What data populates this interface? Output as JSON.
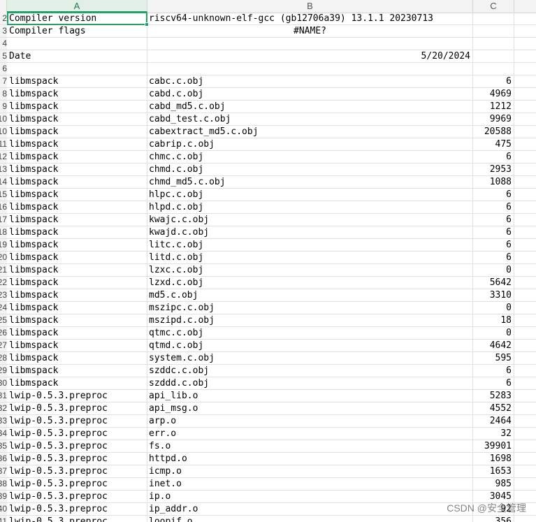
{
  "columns": [
    "A",
    "B",
    "C"
  ],
  "active_column": "A",
  "header_rows": [
    {
      "row": "2",
      "a": "Compiler version",
      "b": "riscv64-unknown-elf-gcc (gb12706a39) 13.1.1 20230713",
      "c": "",
      "b_align": "overflow"
    },
    {
      "row": "3",
      "a": "Compiler flags",
      "b": "#NAME?",
      "c": "",
      "b_align": "center"
    },
    {
      "row": "4",
      "a": "",
      "b": "",
      "c": "",
      "b_align": ""
    },
    {
      "row": "5",
      "a": "Date",
      "b": "5/20/2024",
      "c": "",
      "b_align": "right"
    },
    {
      "row": "6",
      "a": "",
      "b": "",
      "c": "",
      "b_align": ""
    }
  ],
  "data_rows": [
    {
      "row": "7",
      "a": "libmspack",
      "b": "cabc.c.obj",
      "c": "6"
    },
    {
      "row": "8",
      "a": "libmspack",
      "b": "cabd.c.obj",
      "c": "4969"
    },
    {
      "row": "9",
      "a": "libmspack",
      "b": "cabd_md5.c.obj",
      "c": "1212"
    },
    {
      "row": "10",
      "a": "libmspack",
      "b": "cabd_test.c.obj",
      "c": "9969"
    },
    {
      "row": "10",
      "a": "libmspack",
      "b": "cabextract_md5.c.obj",
      "c": "20588"
    },
    {
      "row": "11",
      "a": "libmspack",
      "b": "cabrip.c.obj",
      "c": "475"
    },
    {
      "row": "12",
      "a": "libmspack",
      "b": "chmc.c.obj",
      "c": "6"
    },
    {
      "row": "13",
      "a": "libmspack",
      "b": "chmd.c.obj",
      "c": "2953"
    },
    {
      "row": "14",
      "a": "libmspack",
      "b": "chmd_md5.c.obj",
      "c": "1088"
    },
    {
      "row": "15",
      "a": "libmspack",
      "b": "hlpc.c.obj",
      "c": "6"
    },
    {
      "row": "16",
      "a": "libmspack",
      "b": "hlpd.c.obj",
      "c": "6"
    },
    {
      "row": "17",
      "a": "libmspack",
      "b": "kwajc.c.obj",
      "c": "6"
    },
    {
      "row": "18",
      "a": "libmspack",
      "b": "kwajd.c.obj",
      "c": "6"
    },
    {
      "row": "19",
      "a": "libmspack",
      "b": "litc.c.obj",
      "c": "6"
    },
    {
      "row": "20",
      "a": "libmspack",
      "b": "litd.c.obj",
      "c": "6"
    },
    {
      "row": "21",
      "a": "libmspack",
      "b": "lzxc.c.obj",
      "c": "0"
    },
    {
      "row": "22",
      "a": "libmspack",
      "b": "lzxd.c.obj",
      "c": "5642"
    },
    {
      "row": "23",
      "a": "libmspack",
      "b": "md5.c.obj",
      "c": "3310"
    },
    {
      "row": "24",
      "a": "libmspack",
      "b": "mszipc.c.obj",
      "c": "0"
    },
    {
      "row": "25",
      "a": "libmspack",
      "b": "mszipd.c.obj",
      "c": "18"
    },
    {
      "row": "26",
      "a": "libmspack",
      "b": "qtmc.c.obj",
      "c": "0"
    },
    {
      "row": "27",
      "a": "libmspack",
      "b": "qtmd.c.obj",
      "c": "4642"
    },
    {
      "row": "28",
      "a": "libmspack",
      "b": "system.c.obj",
      "c": "595"
    },
    {
      "row": "29",
      "a": "libmspack",
      "b": "szddc.c.obj",
      "c": "6"
    },
    {
      "row": "30",
      "a": "libmspack",
      "b": "szddd.c.obj",
      "c": "6"
    },
    {
      "row": "31",
      "a": "lwip-0.5.3.preproc",
      "b": "api_lib.o",
      "c": "5283"
    },
    {
      "row": "32",
      "a": "lwip-0.5.3.preproc",
      "b": "api_msg.o",
      "c": "4552"
    },
    {
      "row": "33",
      "a": "lwip-0.5.3.preproc",
      "b": "arp.o",
      "c": "2464"
    },
    {
      "row": "34",
      "a": "lwip-0.5.3.preproc",
      "b": "err.o",
      "c": "32"
    },
    {
      "row": "35",
      "a": "lwip-0.5.3.preproc",
      "b": "fs.o",
      "c": "39901"
    },
    {
      "row": "36",
      "a": "lwip-0.5.3.preproc",
      "b": "httpd.o",
      "c": "1698"
    },
    {
      "row": "37",
      "a": "lwip-0.5.3.preproc",
      "b": "icmp.o",
      "c": "1653"
    },
    {
      "row": "38",
      "a": "lwip-0.5.3.preproc",
      "b": "inet.o",
      "c": "985"
    },
    {
      "row": "39",
      "a": "lwip-0.5.3.preproc",
      "b": "ip.o",
      "c": "3045"
    },
    {
      "row": "40",
      "a": "lwip-0.5.3.preproc",
      "b": "ip_addr.o",
      "c": "92"
    },
    {
      "row": "41",
      "a": "lwip-0.5.3.preproc",
      "b": "loopif.o",
      "c": "356"
    }
  ],
  "watermark": "CSDN @安全管理"
}
